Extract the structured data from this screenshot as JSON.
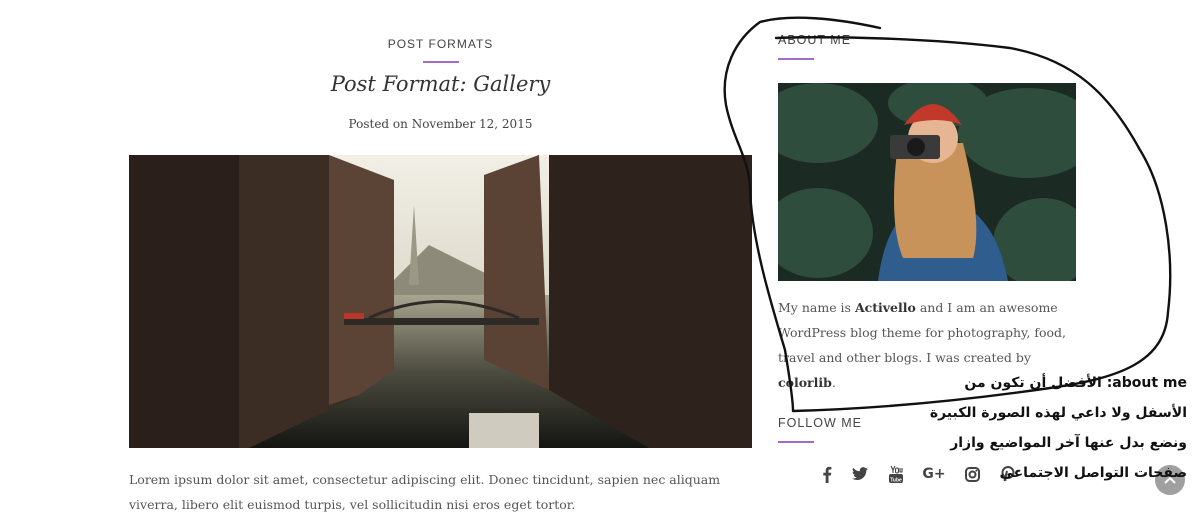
{
  "post": {
    "category": "POST FORMATS",
    "title": "Post Format: Gallery",
    "meta_prefix": "Posted on",
    "date": "November 12, 2015",
    "excerpt": "Lorem ipsum dolor sit amet, consectetur adipiscing elit. Donec tincidunt, sapien nec aliquam viverra, libero elit euismod turpis, vel sollicitudin nisi eros eget tortor.",
    "image_icon": "canal-city-photo"
  },
  "sidebar": {
    "about": {
      "title": "ABOUT ME",
      "photo_icon": "woman-with-camera-photo",
      "text_1": "My name is ",
      "name": "Activello",
      "text_2": " and I am an awesome WordPress blog theme for photography, food, travel and other blogs. I was created by ",
      "creator": "colorlib",
      "text_3": "."
    },
    "follow": {
      "title": "FOLLOW ME",
      "icons": [
        "facebook-icon",
        "twitter-icon",
        "youtube-icon",
        "google-plus-icon",
        "instagram-icon",
        "pinterest-icon"
      ],
      "google_plus_label": "G+"
    }
  },
  "annotation": {
    "line_1": "about me: الأفضل أن تكون من",
    "line_2": "الأسفل ولا داعي لهذه الصورة الكبيرة",
    "line_3": "ونضع بدل عنها آخر المواضيع وازار",
    "line_4": "صفحات التواصل الاجتماعي"
  },
  "colors": {
    "accent": "#a36bc7",
    "text": "#555555",
    "heading": "#333333"
  }
}
